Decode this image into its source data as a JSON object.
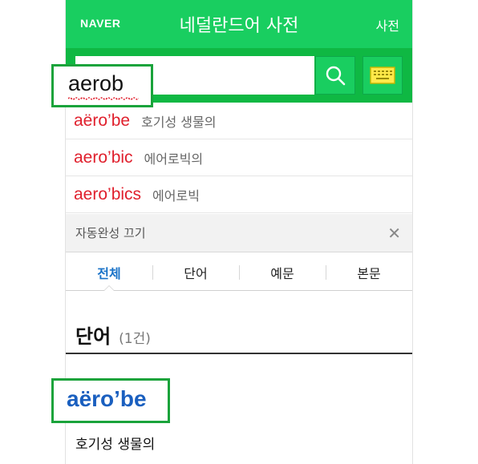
{
  "header": {
    "logo": "NAVER",
    "title": "네덜란드어 사전",
    "right_link": "사전"
  },
  "search": {
    "query": "aerob",
    "search_icon": "search-icon",
    "keyboard_icon": "keyboard-icon"
  },
  "autocomplete": {
    "items": [
      {
        "word": "aëro’be",
        "meaning": "호기성 생물의"
      },
      {
        "word": "aero’bic",
        "meaning": "에어로빅의"
      },
      {
        "word": "aero’bics",
        "meaning": "에어로빅"
      }
    ],
    "off_label": "자동완성 끄기",
    "close_icon": "close-icon",
    "close_glyph": "✕"
  },
  "tabs": [
    {
      "label": "전체",
      "active": true
    },
    {
      "label": "단어",
      "active": false
    },
    {
      "label": "예문",
      "active": false
    },
    {
      "label": "본문",
      "active": false
    }
  ],
  "section": {
    "title": "단어",
    "count": "(1건)"
  },
  "entry": {
    "word": "aëro’be",
    "meaning": "호기성 생물의"
  },
  "colors": {
    "brand_green": "#19ce60",
    "search_bar_green": "#0fb843",
    "highlight_green": "#1aa33b",
    "ac_word_red": "#e0202d",
    "entry_blue": "#1a5fbf",
    "active_tab_blue": "#1a73c8"
  }
}
